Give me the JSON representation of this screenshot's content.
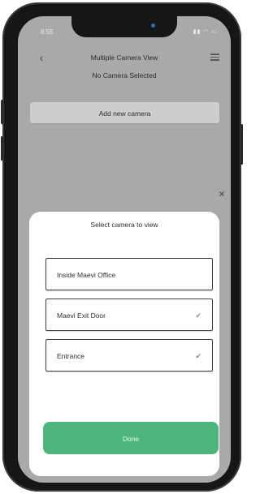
{
  "status_bar": {
    "time": "8:55",
    "icons": [
      "signal-icon",
      "wifi-icon",
      "battery-icon"
    ]
  },
  "header": {
    "title": "Multiple Camera View",
    "subtitle": "No Camera Selected",
    "back_icon": "chevron-left-icon",
    "menu_icon": "hamburger-menu-icon"
  },
  "actions": {
    "add_camera_label": "Add new camera"
  },
  "sheet": {
    "title": "Select camera to view",
    "options": [
      {
        "label": "Inside Maevi Office",
        "checked": false
      },
      {
        "label": "Maevi Exit Door",
        "checked": true
      },
      {
        "label": "Entrance",
        "checked": true
      }
    ],
    "done_label": "Done"
  },
  "colors": {
    "overlay_background": "#a9a9a9",
    "done_button": "#4db67a",
    "sheet_background": "#ffffff"
  }
}
